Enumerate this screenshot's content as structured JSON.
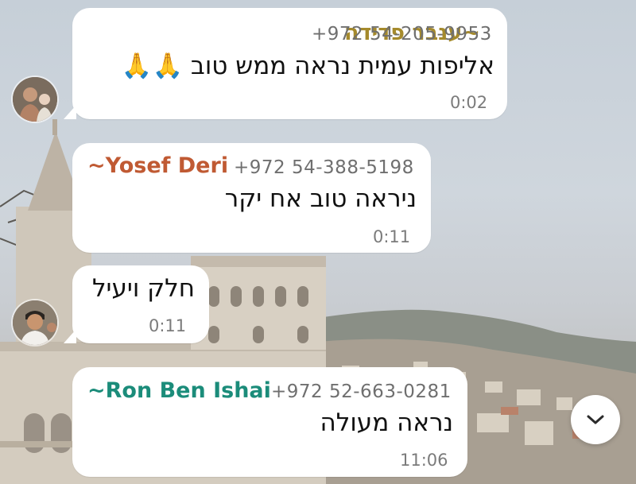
{
  "messages": [
    {
      "sender": "~ענבר פדידה",
      "sender_color": "#a58a2c",
      "phone": "+972 54-205-9953",
      "text": "אליפות עמית נראה ממש טוב",
      "emoji": "🙏🙏",
      "time": "0:02"
    },
    {
      "sender": "~Yosef Deri",
      "sender_color": "#c05a33",
      "phone": "+972 54-388-5198",
      "text": "ניראה טוב אח יקר",
      "time": "0:11"
    },
    {
      "text": "חלק ויעיל",
      "time": "0:11"
    },
    {
      "sender": "~Ron Ben Ishai",
      "sender_color": "#1b8c7a",
      "phone": "+972 52-663-0281",
      "text": "נראה מעולה",
      "time": "11:06"
    }
  ],
  "colors": {
    "bubble": "#ffffff",
    "phone_text": "#6f6f6f",
    "time_text": "#7b7b7b"
  },
  "icons": {
    "scroll_down": "chevron-down-icon"
  }
}
